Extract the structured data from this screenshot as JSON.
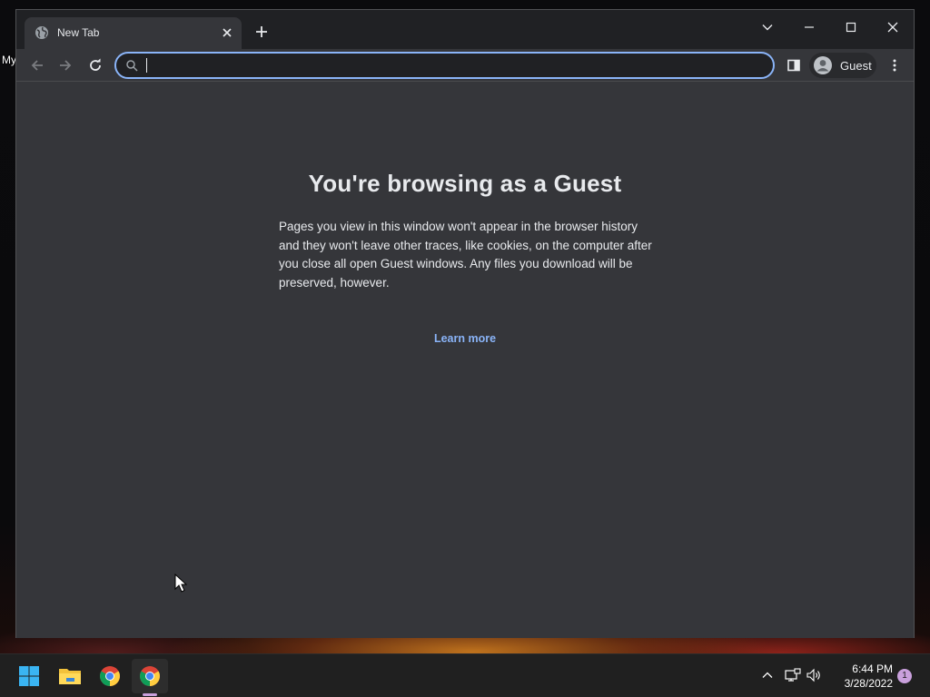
{
  "desktop": {
    "icon_label": "My"
  },
  "browser": {
    "tab": {
      "title": "New Tab",
      "favicon": "globe-icon"
    },
    "window_controls": [
      "tab-search",
      "minimize",
      "maximize",
      "close"
    ],
    "omnibox": {
      "value": "",
      "placeholder": ""
    },
    "profile": {
      "label": "Guest"
    },
    "content": {
      "heading": "You're browsing as a Guest",
      "body": "Pages you view in this window won't appear in the browser history and they won't leave other traces, like cookies, on the computer after you close all open Guest windows. Any files you download will be preserved, however.",
      "learn_more": "Learn more"
    }
  },
  "taskbar": {
    "apps": [
      "start",
      "file-explorer",
      "chrome",
      "chrome"
    ],
    "clock": {
      "time": "6:44 PM",
      "date": "3/28/2022"
    },
    "notification_count": "1"
  },
  "colors": {
    "accent": "#8ab4f8",
    "background": "#35363a",
    "titlebar": "#202124",
    "text": "#e8eaed",
    "taskbar": "#202020",
    "notification": "#c9a0dc"
  }
}
